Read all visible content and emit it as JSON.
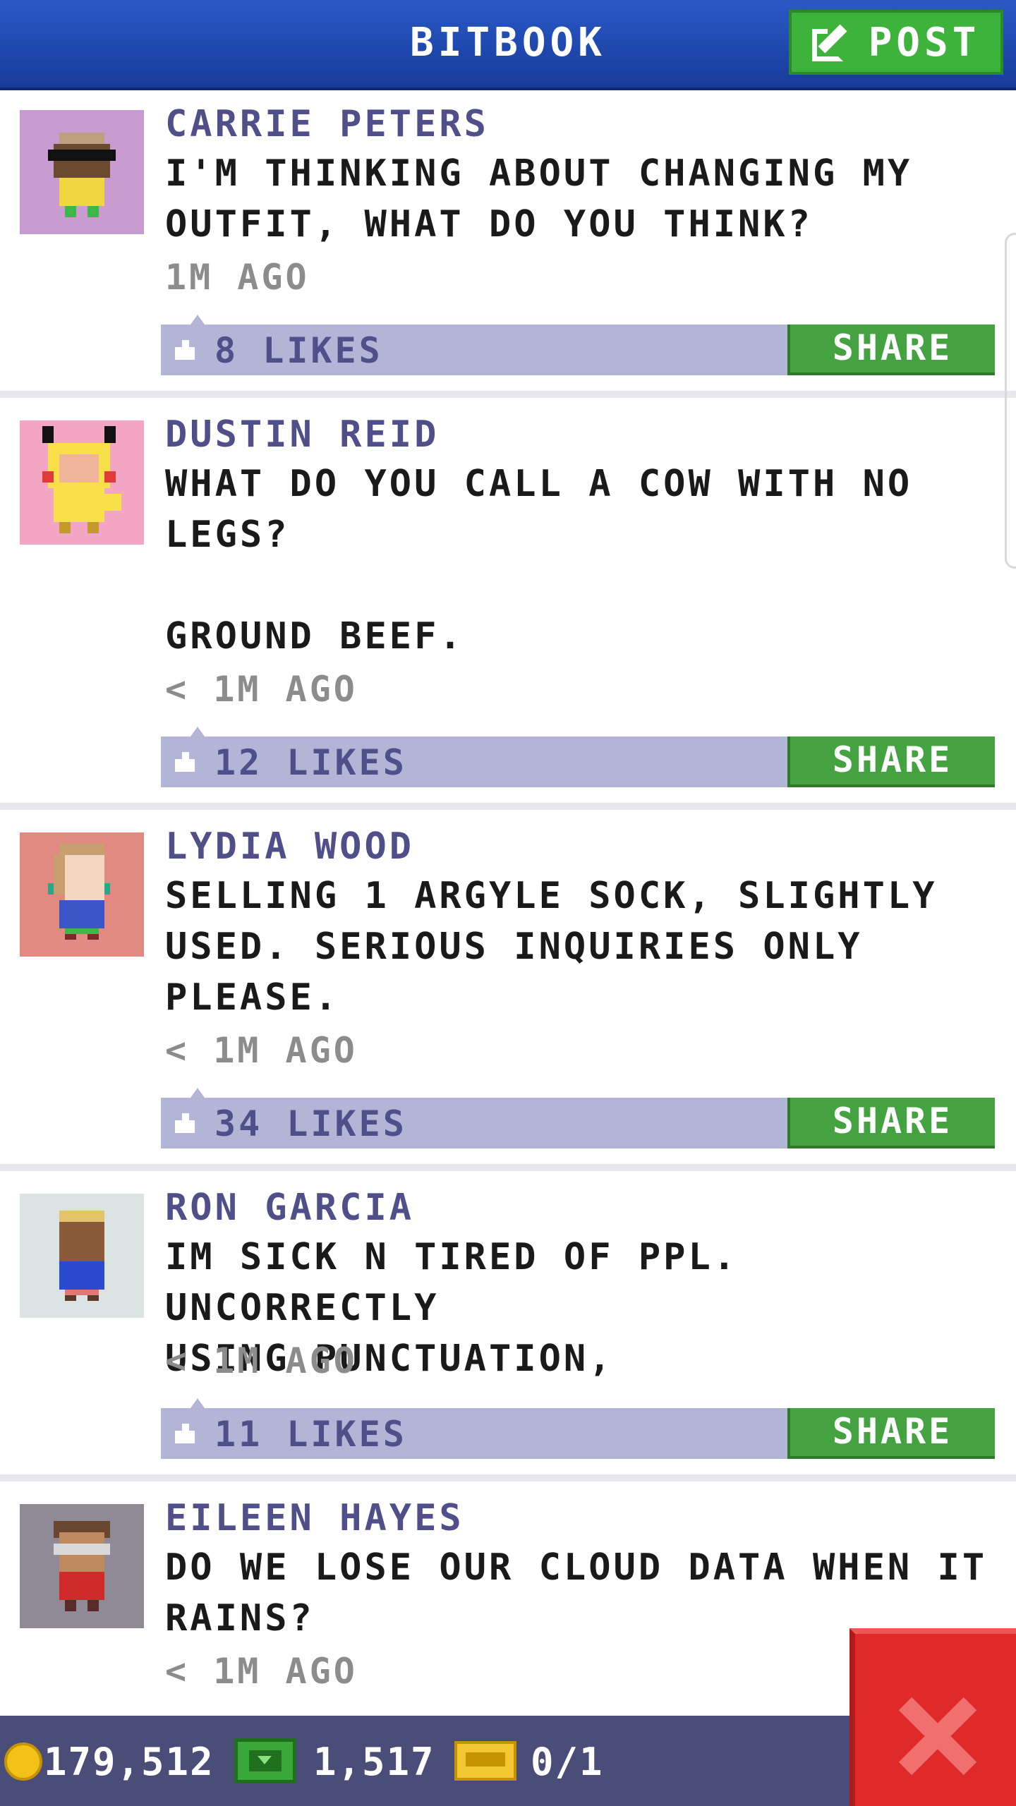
{
  "header": {
    "title": "BITBOOK",
    "post_label": "POST"
  },
  "posts": [
    {
      "author": "CARRIE PETERS",
      "text": "I'M THINKING ABOUT CHANGING MY\nOUTFIT, WHAT DO YOU THINK?",
      "time": "1M AGO",
      "likes": "8 LIKES",
      "share": "SHARE",
      "avatar_bg": "#c89bd1"
    },
    {
      "author": "DUSTIN REID",
      "text": "WHAT DO YOU CALL A COW WITH NO\nLEGS?\n\nGROUND BEEF.",
      "time": "< 1M AGO",
      "likes": "12 LIKES",
      "share": "SHARE",
      "avatar_bg": "#f2a6c4"
    },
    {
      "author": "LYDIA WOOD",
      "text": "SELLING 1 ARGYLE SOCK, SLIGHTLY\nUSED. SERIOUS INQUIRIES ONLY\nPLEASE.",
      "time": "< 1M AGO",
      "likes": "34 LIKES",
      "share": "SHARE",
      "avatar_bg": "#e08a82"
    },
    {
      "author": "RON GARCIA",
      "text": "IM SICK N TIRED OF PPL. UNCORRECTLY\nUSING PUNCTUATION,",
      "time": "< 1M AGO",
      "likes": "11 LIKES",
      "share": "SHARE",
      "avatar_bg": "#dce3e3"
    },
    {
      "author": "EILEEN HAYES",
      "text": "DO WE LOSE OUR CLOUD DATA WHEN IT\nRAINS?",
      "time": "< 1M AGO",
      "likes": "",
      "share": "",
      "avatar_bg": "#8f8a95"
    }
  ],
  "footer": {
    "coins": "179,512",
    "bux": "1,517",
    "tickets": "0/1"
  },
  "icons": {
    "post": "edit-icon",
    "like": "thumbs-up-icon",
    "coin": "coin-icon",
    "bux": "bux-icon",
    "ticket": "ticket-icon",
    "close": "close-icon"
  },
  "colors": {
    "header": "#1f4bb5",
    "post_button": "#3db33b",
    "share_button": "#44a340",
    "likes_bar": "#b3b5d6",
    "author": "#4f4f8a",
    "footer": "#4a4d78",
    "close_button": "#e02a2a"
  }
}
